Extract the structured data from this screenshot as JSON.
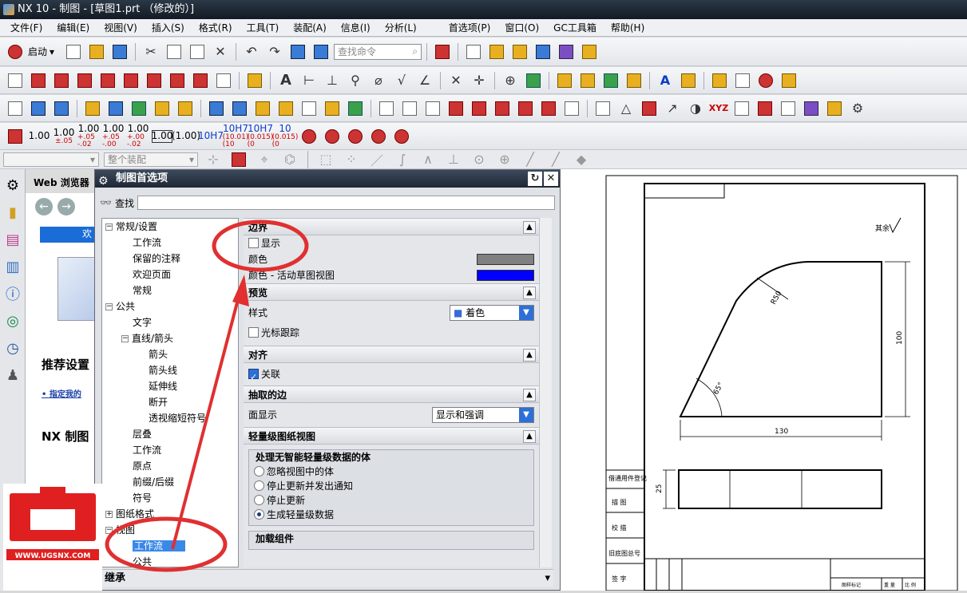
{
  "title": "NX 10 - 制图 - [草图1.prt （修改的）]",
  "menu": [
    "文件(F)",
    "编辑(E)",
    "视图(V)",
    "插入(S)",
    "格式(R)",
    "工具(T)",
    "装配(A)",
    "信息(I)",
    "分析(L)",
    "首选项(P)",
    "窗口(O)",
    "GC工具箱",
    "帮助(H)"
  ],
  "toolbar": {
    "start_label": "启动",
    "search_placeholder": "查找命令"
  },
  "tolerances": [
    {
      "big": "1.00",
      "sub": ""
    },
    {
      "big": "1.00",
      "sub": "±.05"
    },
    {
      "big": "1.00",
      "sub": "+.05 -.02"
    },
    {
      "big": "1.00",
      "sub": "+.05 -.00"
    },
    {
      "big": "1.00",
      "sub": "+.00 -.02"
    },
    {
      "big": "1.00",
      "sub": "box"
    },
    {
      "big": "(1.00)",
      "sub": ""
    },
    {
      "big": "10H7",
      "sub": ""
    },
    {
      "big": "10H7",
      "sub": "(10.01) (10"
    },
    {
      "big": "10H7",
      "sub": "(0.015) (0"
    },
    {
      "big": "10",
      "sub": "(0.015) (0"
    }
  ],
  "selection_bar": {
    "filter": "",
    "scope": "整个装配"
  },
  "web": {
    "title": "Web 浏览器",
    "banner": "欢",
    "heading": "推荐设置",
    "link": "指定我的",
    "heading2": "NX 制图"
  },
  "dialog": {
    "title": "制图首选项",
    "find_label": "查找",
    "tree": [
      {
        "label": "常规/设置",
        "level": 0,
        "exp": "−"
      },
      {
        "label": "工作流",
        "level": 1
      },
      {
        "label": "保留的注释",
        "level": 1
      },
      {
        "label": "欢迎页面",
        "level": 1
      },
      {
        "label": "常规",
        "level": 1
      },
      {
        "label": "公共",
        "level": 0,
        "exp": "−"
      },
      {
        "label": "文字",
        "level": 1
      },
      {
        "label": "直线/箭头",
        "level": 1,
        "exp": "−"
      },
      {
        "label": "箭头",
        "level": 2
      },
      {
        "label": "箭头线",
        "level": 2
      },
      {
        "label": "延伸线",
        "level": 2
      },
      {
        "label": "断开",
        "level": 2
      },
      {
        "label": "透视缩短符号",
        "level": 2
      },
      {
        "label": "层叠",
        "level": 1
      },
      {
        "label": "工作流",
        "level": 1
      },
      {
        "label": "原点",
        "level": 1
      },
      {
        "label": "前缀/后缀",
        "level": 1
      },
      {
        "label": "符号",
        "level": 1
      },
      {
        "label": "图纸格式",
        "level": 0,
        "exp": "+"
      },
      {
        "label": "视图",
        "level": 0,
        "exp": "−"
      },
      {
        "label": "工作流",
        "level": 1,
        "selected": true
      },
      {
        "label": "公共",
        "level": 1
      }
    ],
    "inherit_label": "继承",
    "sections": {
      "boundary": {
        "title": "边界",
        "show_label": "显示",
        "show_checked": false,
        "color_label": "颜色",
        "color": "#808080",
        "active_label": "颜色 - 活动草图视图",
        "active_color": "#0000ff"
      },
      "preview": {
        "title": "预览",
        "style_label": "样式",
        "style_value": "着色",
        "cursor_label": "光标跟踪"
      },
      "align": {
        "title": "对齐",
        "assoc_label": "关联"
      },
      "edges": {
        "title": "抽取的边",
        "face_label": "面显示",
        "face_value": "显示和强调"
      },
      "lightweight": {
        "title": "轻量级图纸视图",
        "group_title": "处理无智能轻量级数据的体",
        "options": [
          "忽略视图中的体",
          "停止更新并发出通知",
          "停止更新",
          "生成轻量级数据"
        ],
        "selected_index": 3,
        "next_group": "加载组件"
      }
    }
  },
  "drawing": {
    "radius_label": "R50",
    "angle_label": "65°",
    "height_label": "100",
    "width_label": "130",
    "side_label": "25",
    "roughness_label": "其余",
    "title_rows": [
      "借通用件登记",
      "描 图",
      "校 描",
      "旧底图总号",
      "签 字"
    ],
    "title_block_cells": [
      "图样标记",
      "重 量",
      "比 例"
    ]
  },
  "watermark": "WWW.UGSNX.COM",
  "colors": {
    "annotation": "#e03030",
    "select": "#3a88e8"
  }
}
